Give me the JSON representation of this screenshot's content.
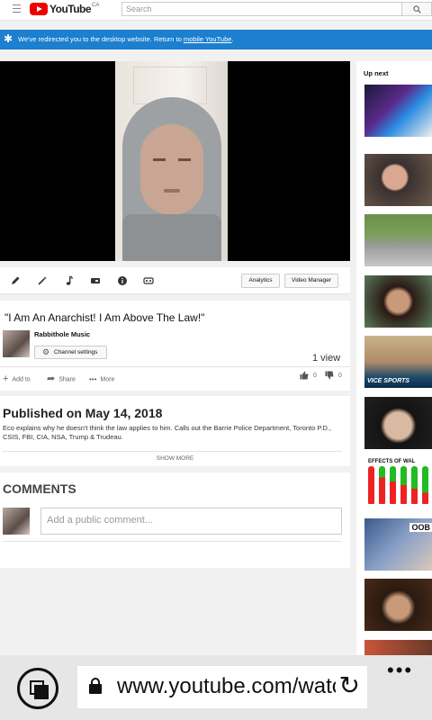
{
  "header": {
    "logo_text": "YouTube",
    "logo_country": "CA",
    "search_placeholder": "Search"
  },
  "banner": {
    "text": "We've redirected you to the desktop website. Return to ",
    "link": "mobile YouTube",
    "trailing": "."
  },
  "toolbar": {
    "icons": [
      "edit-icon",
      "enhance-icon",
      "audio-icon",
      "end-screen-icon",
      "info-icon",
      "subtitles-icon"
    ],
    "analytics_label": "Analytics",
    "video_manager_label": "Video Manager"
  },
  "video": {
    "title": "\"I Am An Anarchist! I Am Above The Law!\"",
    "channel": "Rabbithole Music",
    "channel_settings_label": "Channel settings",
    "views": "1 view",
    "add_to_label": "Add to",
    "share_label": "Share",
    "more_label": "More",
    "likes": "0",
    "dislikes": "0"
  },
  "description": {
    "published": "Published on May 14, 2018",
    "text": "Eco explains why he doesn't think the law applies to him. Calls out the Barrie Police Department, Toronto P.D., CSIS, FBI, CIA, NSA, Trump & Trudeau.",
    "show_more": "SHOW MORE"
  },
  "comments": {
    "heading": "COMMENTS",
    "placeholder": "Add a public comment..."
  },
  "sidebar": {
    "heading": "Up next",
    "thumb_vice": "VICE SPORTS",
    "thumb_effects": "EFFECTS OF WAL",
    "thumb_oob": "OOB"
  },
  "browser": {
    "url": "www.youtube.com/watch",
    "more": "•••"
  }
}
